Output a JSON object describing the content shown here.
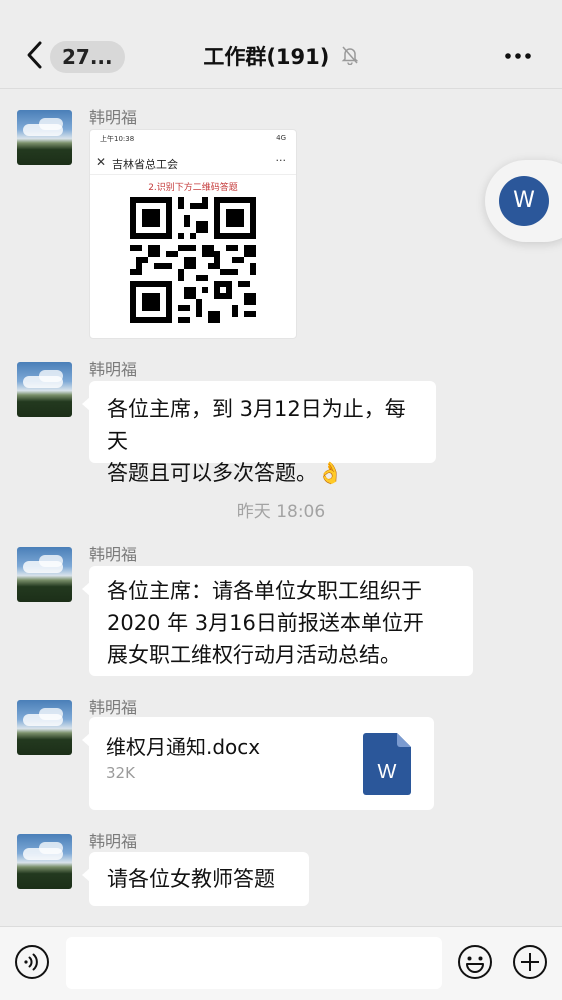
{
  "header": {
    "back_count": "27...",
    "title": "工作群(191)",
    "muted_icon": "bell-off-icon",
    "more_icon": "more-dots-icon"
  },
  "messages": [
    {
      "sender": "韩明福",
      "type": "image",
      "image": {
        "status_time": "上午10:38",
        "status_right": "4G",
        "page_title": "吉林省总工会",
        "hint": "2.识别下方二维码答题"
      }
    },
    {
      "sender": "韩明福",
      "type": "text",
      "lines": [
        "各位主席，到 3月12日为止，每天",
        "答题且可以多次答题。👌"
      ]
    },
    {
      "sender": "韩明福",
      "type": "text",
      "lines": [
        "各位主席：请各单位女职工组织于",
        "2020 年 3月16日前报送本单位开",
        "展女职工维权行动月活动总结。"
      ]
    },
    {
      "sender": "韩明福",
      "type": "file",
      "file": {
        "name": "维权月通知.docx",
        "size": "32K",
        "icon_label": "W"
      }
    },
    {
      "sender": "韩明福",
      "type": "text",
      "lines": [
        "请各位女教师答题"
      ]
    }
  ],
  "time_divider": "昨天 18:06",
  "floating_button": {
    "label": "W"
  },
  "bottombar": {
    "voice_icon": "voice-icon",
    "emoji_icon": "emoji-icon",
    "plus_icon": "plus-icon"
  },
  "colors": {
    "accent_word_blue": "#2b579a",
    "bubble": "#ffffff",
    "background": "#ededed"
  }
}
